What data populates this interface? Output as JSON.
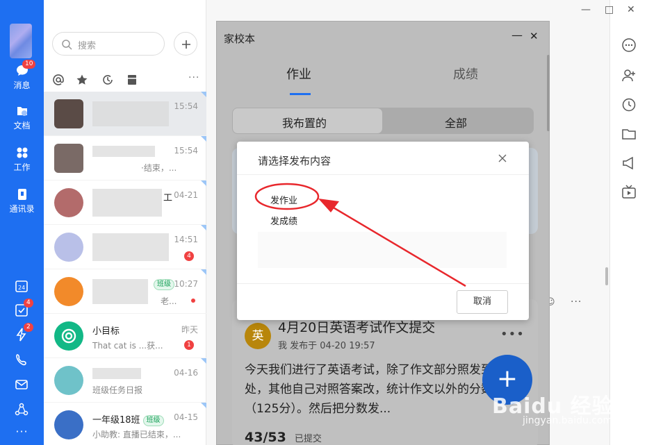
{
  "rail": {
    "items": [
      {
        "label": "消息",
        "badge": "10"
      },
      {
        "label": "文档"
      },
      {
        "label": "工作"
      },
      {
        "label": "通讯录"
      }
    ],
    "bottom_badges": {
      "tasks": "4",
      "flash": "2"
    }
  },
  "sessions": {
    "search_placeholder": "搜索",
    "more": "···",
    "rows": [
      {
        "name": "",
        "message": "",
        "time": "15:54"
      },
      {
        "name": "",
        "message": "·结束，...",
        "time": "15:54"
      },
      {
        "name": "工",
        "message": "",
        "time": "04-21"
      },
      {
        "name": "",
        "message": "",
        "time": "14:51",
        "badge": "4"
      },
      {
        "name": "",
        "tag": "班级",
        "message": "老...",
        "time": "10:27"
      },
      {
        "name": "小目标",
        "message": "That  cat  is   ...获...",
        "time": "昨天",
        "badge": "1"
      },
      {
        "name": "",
        "message": "班级任务日报",
        "time": "04-16"
      },
      {
        "name": "一年级18班",
        "tag": "班级",
        "message": "小助教: 直播已结束，...",
        "time": "04-15"
      }
    ]
  },
  "homework_window": {
    "title": "家校本",
    "tabs": [
      "作业",
      "成绩"
    ],
    "segments": [
      "我布置的",
      "全部"
    ],
    "card": {
      "subject_badge": "英",
      "title": "4月20日英语考试作文提交",
      "meta_prefix": "我",
      "meta": "发布于 04-20 19:57",
      "body": "今天我们进行了英语考试，除了作文部分照发到此处，其他自己对照答案改，统计作文以外的分数（125分）。然后把分数发...",
      "count": "43/53",
      "count_label": "已提交"
    },
    "fab": "+"
  },
  "dialog": {
    "title": "请选择发布内容",
    "options": [
      "发作业",
      "发成绩"
    ],
    "cancel": "取消"
  },
  "watermark": {
    "brand": "Baidu 经验",
    "url": "jingyan.baidu.com"
  },
  "colors": {
    "accent": "#1e6ff1",
    "annotation": "#e8272c",
    "badge": "#f04141"
  }
}
